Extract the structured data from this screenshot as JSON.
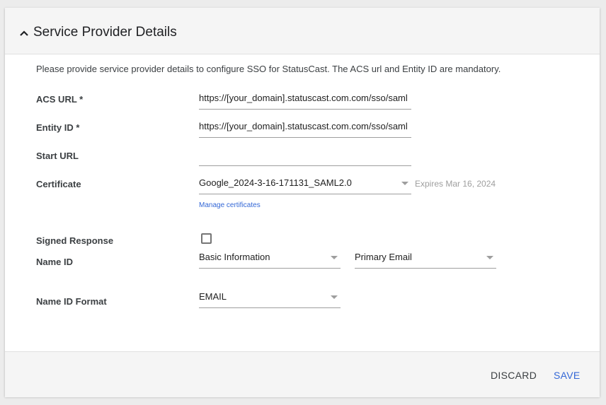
{
  "section": {
    "title": "Service Provider Details",
    "intro": "Please provide service provider details to configure SSO for StatusCast. The ACS url and Entity ID are mandatory."
  },
  "fields": {
    "acs_url": {
      "label": "ACS URL *",
      "value": "https://[your_domain].statuscast.com.com/sso/saml"
    },
    "entity_id": {
      "label": "Entity ID *",
      "value": "https://[your_domain].statuscast.com.com/sso/saml"
    },
    "start_url": {
      "label": "Start URL",
      "value": ""
    },
    "certificate": {
      "label": "Certificate",
      "selected": "Google_2024-3-16-171131_SAML2.0",
      "expires": "Expires Mar 16, 2024",
      "manage_link": "Manage certificates"
    },
    "signed_response": {
      "label": "Signed Response",
      "checked": false
    },
    "name_id": {
      "label": "Name ID",
      "category": "Basic Information",
      "attribute": "Primary Email"
    },
    "name_id_format": {
      "label": "Name ID Format",
      "selected": "EMAIL"
    }
  },
  "footer": {
    "discard_label": "DISCARD",
    "save_label": "SAVE"
  },
  "colors": {
    "accent": "#3367d6",
    "header_bg": "#f5f5f5",
    "muted_text": "#9e9e9e"
  },
  "icons": {
    "collapse": "chevron-up-icon",
    "dropdown": "caret-down-icon"
  }
}
